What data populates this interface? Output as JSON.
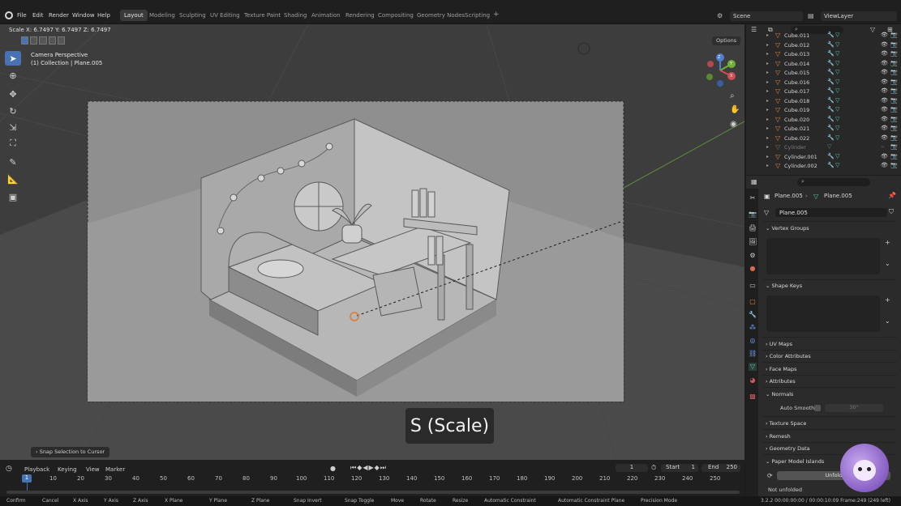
{
  "menubar": {
    "items": [
      "File",
      "Edit",
      "Render",
      "Window",
      "Help"
    ],
    "workspaces": [
      "Layout",
      "Modeling",
      "Sculpting",
      "UV Editing",
      "Texture Paint",
      "Shading",
      "Animation",
      "Rendering",
      "Compositing",
      "Geometry Nodes",
      "Scripting"
    ],
    "add_tab": "+",
    "scene": "Scene",
    "view_layer": "ViewLayer"
  },
  "viewport": {
    "header_readout": "Scale X: 6.7497   Y: 6.7497   Z: 6.7497",
    "camera_label": "Camera Perspective",
    "collection_label": "(1) Collection | Plane.005",
    "options_label": "Options",
    "overlay_text": "S (Scale)",
    "snap_label": "Snap Selection to Cursor",
    "gizmo_labels": {
      "x": "X",
      "y": "Y",
      "z": "Z"
    }
  },
  "timeline": {
    "menus": [
      "Playback",
      "Keying",
      "View",
      "Marker"
    ],
    "current_frame": "1",
    "start_label": "Start",
    "start_value": "1",
    "end_label": "End",
    "end_value": "250",
    "ruler": [
      "1",
      "10",
      "20",
      "30",
      "40",
      "50",
      "60",
      "70",
      "80",
      "90",
      "100",
      "110",
      "120",
      "130",
      "140",
      "150",
      "160",
      "170",
      "180",
      "190",
      "200",
      "210",
      "220",
      "230",
      "240",
      "250"
    ]
  },
  "statusbar": {
    "items": [
      "Confirm",
      "Cancel",
      "X Axis",
      "Y Axis",
      "Z Axis",
      "X Plane",
      "Y Plane",
      "Z Plane",
      "Snap Invert",
      "Snap Toggle",
      "Move",
      "Rotate",
      "Resize",
      "Automatic Constraint",
      "Automatic Constraint Plane",
      "Precision Mode"
    ],
    "right": "3.2.2   00:00:00:00 / 00:00:10:09   Frame:249 (249 left)"
  },
  "outliner": {
    "rows": [
      {
        "name": "Cube.011",
        "disabled": false
      },
      {
        "name": "Cube.012",
        "disabled": false
      },
      {
        "name": "Cube.013",
        "disabled": false
      },
      {
        "name": "Cube.014",
        "disabled": false
      },
      {
        "name": "Cube.015",
        "disabled": false
      },
      {
        "name": "Cube.016",
        "disabled": false
      },
      {
        "name": "Cube.017",
        "disabled": false
      },
      {
        "name": "Cube.018",
        "disabled": false
      },
      {
        "name": "Cube.019",
        "disabled": false
      },
      {
        "name": "Cube.020",
        "disabled": false
      },
      {
        "name": "Cube.021",
        "disabled": false
      },
      {
        "name": "Cube.022",
        "disabled": false
      },
      {
        "name": "Cylinder",
        "disabled": true
      },
      {
        "name": "Cylinder.001",
        "disabled": false
      },
      {
        "name": "Cylinder.002",
        "disabled": false
      }
    ]
  },
  "properties": {
    "breadcrumb_object": "Plane.005",
    "breadcrumb_mesh": "Plane.005",
    "mesh_name": "Plane.005",
    "panels": {
      "vertex_groups": "Vertex Groups",
      "shape_keys": "Shape Keys",
      "uv_maps": "UV Maps",
      "color_attributes": "Color Attributes",
      "face_maps": "Face Maps",
      "attributes": "Attributes",
      "normals": "Normals",
      "auto_smooth_label": "Auto Smooth",
      "auto_smooth_angle": "30°",
      "texture_space": "Texture Space",
      "remesh": "Remesh",
      "geometry_data": "Geometry Data",
      "paper_model": "Paper Model Islands",
      "unfold_button": "Unfold",
      "not_unfolded": "Not unfolded"
    }
  },
  "colors": {
    "accent": "#4772b3",
    "object_orange": "#e08a3c",
    "mesh_green": "#4dd0b0",
    "modifier_blue": "#6fa8ff"
  }
}
